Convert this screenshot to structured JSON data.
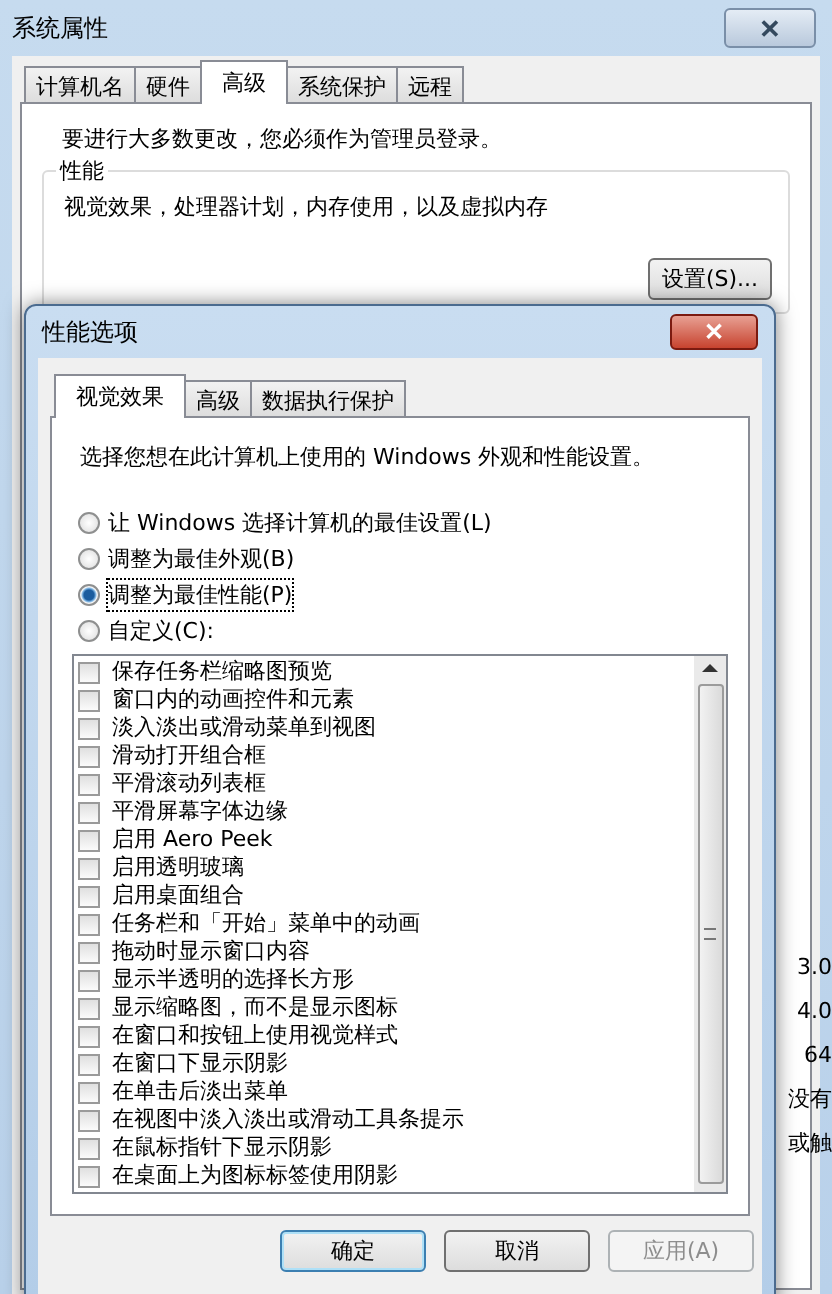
{
  "window": {
    "title": "系统属性",
    "close": "✕"
  },
  "tabs": [
    {
      "label": "计算机名",
      "selected": false
    },
    {
      "label": "硬件",
      "selected": false
    },
    {
      "label": "高级",
      "selected": true
    },
    {
      "label": "系统保护",
      "selected": false
    },
    {
      "label": "远程",
      "selected": false
    }
  ],
  "admin_note": "要进行大多数更改，您必须作为管理员登录。",
  "performance": {
    "legend": "性能",
    "description": "视觉效果，处理器计划，内存使用，以及虚拟内存",
    "button": "设置(S)..."
  },
  "background_fragments": [
    "3.0",
    "4.0",
    "64",
    "没有",
    "或触"
  ],
  "dialog": {
    "title": "性能选项",
    "close": "✕",
    "tabs": [
      {
        "label": "视觉效果",
        "selected": true
      },
      {
        "label": "高级",
        "selected": false
      },
      {
        "label": "数据执行保护",
        "selected": false
      }
    ],
    "intro": "选择您想在此计算机上使用的 Windows 外观和性能设置。",
    "options": [
      {
        "label": "让 Windows 选择计算机的最佳设置(L)",
        "selected": false
      },
      {
        "label": "调整为最佳外观(B)",
        "selected": false
      },
      {
        "label": "调整为最佳性能(P)",
        "selected": true
      },
      {
        "label": "自定义(C):",
        "selected": false
      }
    ],
    "effects": [
      {
        "label": "保存任务栏缩略图预览",
        "checked": false
      },
      {
        "label": "窗口内的动画控件和元素",
        "checked": false
      },
      {
        "label": "淡入淡出或滑动菜单到视图",
        "checked": false
      },
      {
        "label": "滑动打开组合框",
        "checked": false
      },
      {
        "label": "平滑滚动列表框",
        "checked": false
      },
      {
        "label": "平滑屏幕字体边缘",
        "checked": false
      },
      {
        "label": "启用 Aero Peek",
        "checked": false
      },
      {
        "label": "启用透明玻璃",
        "checked": false
      },
      {
        "label": "启用桌面组合",
        "checked": false
      },
      {
        "label": "任务栏和「开始」菜单中的动画",
        "checked": false
      },
      {
        "label": "拖动时显示窗口内容",
        "checked": false
      },
      {
        "label": "显示半透明的选择长方形",
        "checked": false
      },
      {
        "label": "显示缩略图，而不是显示图标",
        "checked": false
      },
      {
        "label": "在窗口和按钮上使用视觉样式",
        "checked": false
      },
      {
        "label": "在窗口下显示阴影",
        "checked": false
      },
      {
        "label": "在单击后淡出菜单",
        "checked": false
      },
      {
        "label": "在视图中淡入淡出或滑动工具条提示",
        "checked": false
      },
      {
        "label": "在鼠标指针下显示阴影",
        "checked": false
      },
      {
        "label": "在桌面上为图标标签使用阴影",
        "checked": false
      }
    ],
    "buttons": [
      {
        "label": "确定",
        "disabled": false,
        "default": true
      },
      {
        "label": "取消",
        "disabled": false,
        "default": false
      },
      {
        "label": "应用(A)",
        "disabled": true,
        "default": false
      }
    ]
  }
}
